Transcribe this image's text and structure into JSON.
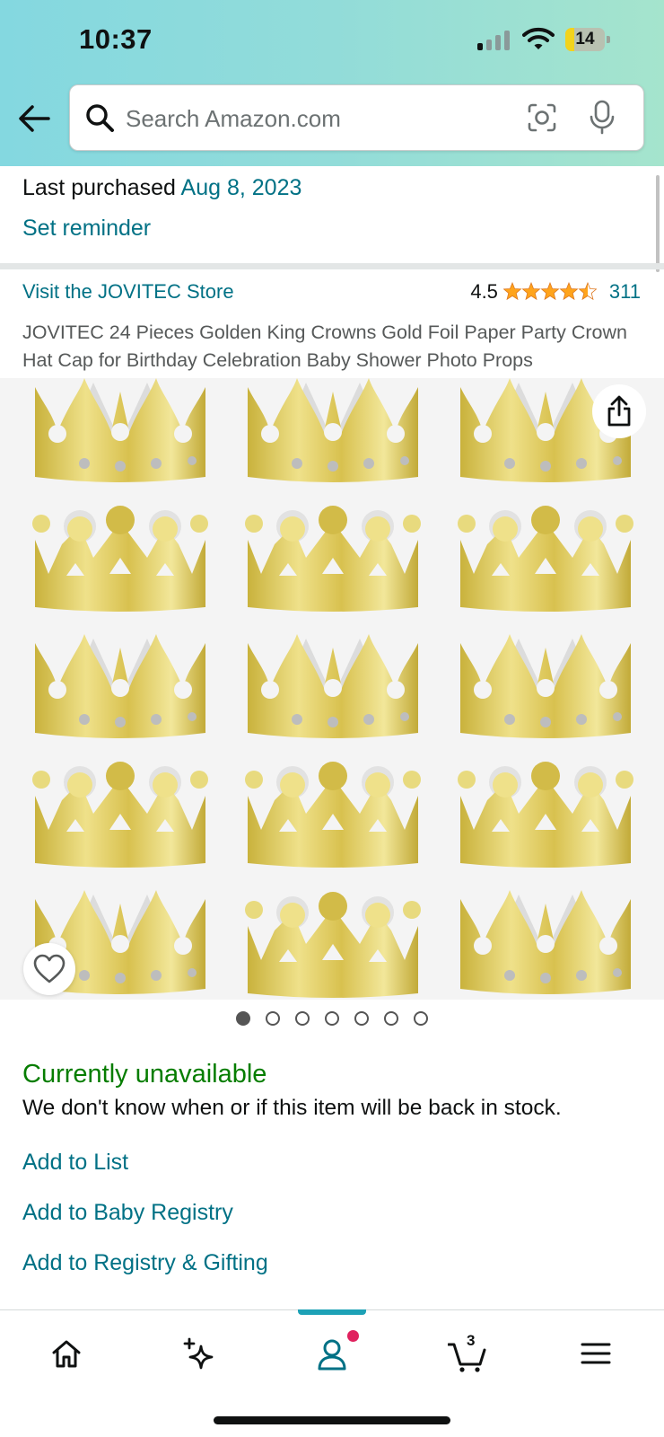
{
  "status_bar": {
    "time": "10:37",
    "battery_level": "14"
  },
  "search": {
    "placeholder": "Search Amazon.com"
  },
  "purchase": {
    "label": "Last purchased",
    "date": "Aug 8, 2023",
    "reminder": "Set reminder"
  },
  "product": {
    "store": "Visit the JOVITEC Store",
    "rating": "4.5",
    "rating_count": "311",
    "title": "JOVITEC 24 Pieces Golden King Crowns Gold Foil Paper Party Crown Hat Cap for Birthday Celebration Baby Shower Photo Props",
    "image_count": 7,
    "active_image": 1
  },
  "availability": {
    "status": "Currently unavailable",
    "message": "We don't know when or if this item will be back in stock."
  },
  "actions": [
    "Add to List",
    "Add to Baby Registry",
    "Add to Registry & Gifting"
  ],
  "tabbar": {
    "items": [
      "home-icon",
      "sparkle-icon",
      "account-icon",
      "cart-icon",
      "menu-icon"
    ],
    "cart_count": "3"
  },
  "colors": {
    "link": "#007185",
    "available_status": "#067d00",
    "star": "#ffa41c",
    "header_gradient_start": "#84d8e0",
    "header_gradient_end": "#a5e4cd",
    "active_tab": "#1da1b6"
  }
}
